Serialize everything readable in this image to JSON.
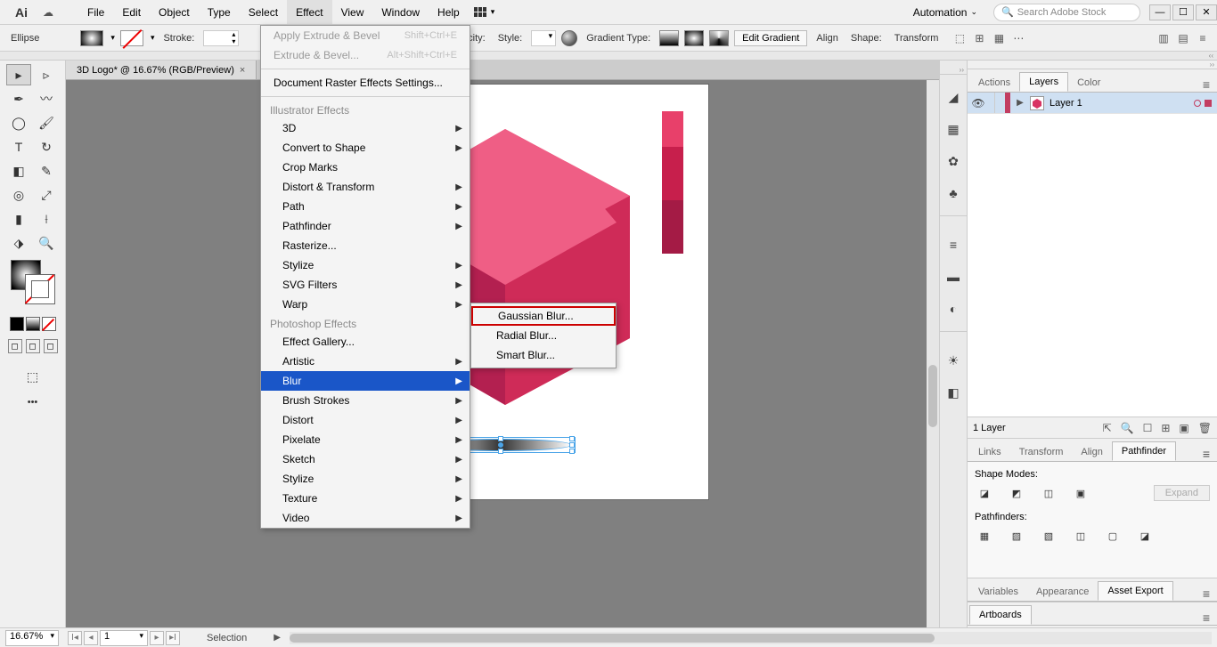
{
  "app": {
    "logo": "Ai"
  },
  "menubar": [
    "File",
    "Edit",
    "Object",
    "Type",
    "Select",
    "Effect",
    "View",
    "Window",
    "Help"
  ],
  "menubar_open": "Effect",
  "automation_label": "Automation",
  "search_placeholder": "Search Adobe Stock",
  "controlbar": {
    "shape": "Ellipse",
    "stroke_label": "Stroke:",
    "opacity_label": "Opacity:",
    "style_label": "Style:",
    "gradient_label": "Gradient Type:",
    "edit_gradient": "Edit Gradient",
    "align_label": "Align",
    "shape_label": "Shape:",
    "transform_label": "Transform"
  },
  "document_tab": "3D Logo* @ 16.67% (RGB/Preview)",
  "effect_menu": {
    "apply": "Apply Extrude & Bevel",
    "apply_sc": "Shift+Ctrl+E",
    "last": "Extrude & Bevel...",
    "last_sc": "Alt+Shift+Ctrl+E",
    "raster_settings": "Document Raster Effects Settings...",
    "ill_header": "Illustrator Effects",
    "ill_items": [
      "3D",
      "Convert to Shape",
      "Crop Marks",
      "Distort & Transform",
      "Path",
      "Pathfinder",
      "Rasterize...",
      "Stylize",
      "SVG Filters",
      "Warp"
    ],
    "ill_subs": [
      true,
      true,
      false,
      true,
      true,
      true,
      false,
      true,
      true,
      true
    ],
    "ps_header": "Photoshop Effects",
    "ps_items": [
      "Effect Gallery...",
      "Artistic",
      "Blur",
      "Brush Strokes",
      "Distort",
      "Pixelate",
      "Sketch",
      "Stylize",
      "Texture",
      "Video"
    ],
    "ps_subs": [
      false,
      true,
      true,
      true,
      true,
      true,
      true,
      true,
      true,
      true
    ],
    "ps_highlight": "Blur"
  },
  "blur_submenu": [
    "Gaussian Blur...",
    "Radial Blur...",
    "Smart Blur..."
  ],
  "right_vstrip_icons": [
    "properties",
    "swatches",
    "symbols",
    "brushes",
    "stroke",
    "gradient",
    "transparency",
    "appearance",
    "graphic-styles"
  ],
  "panels": {
    "group1_tabs": [
      "Actions",
      "Layers",
      "Color"
    ],
    "group1_active": "Layers",
    "layer_name": "Layer 1",
    "layers_count": "1 Layer",
    "group2_tabs": [
      "Links",
      "Transform",
      "Align",
      "Pathfinder"
    ],
    "group2_active": "Pathfinder",
    "pf_shape_modes": "Shape Modes:",
    "pf_expand": "Expand",
    "pf_pathfinders": "Pathfinders:",
    "group3_tabs": [
      "Variables",
      "Appearance",
      "Asset Export"
    ],
    "group3_active": "Asset Export",
    "group4_tab": "Artboards"
  },
  "statusbar": {
    "zoom": "16.67%",
    "artboard_num": "1",
    "selection": "Selection"
  }
}
